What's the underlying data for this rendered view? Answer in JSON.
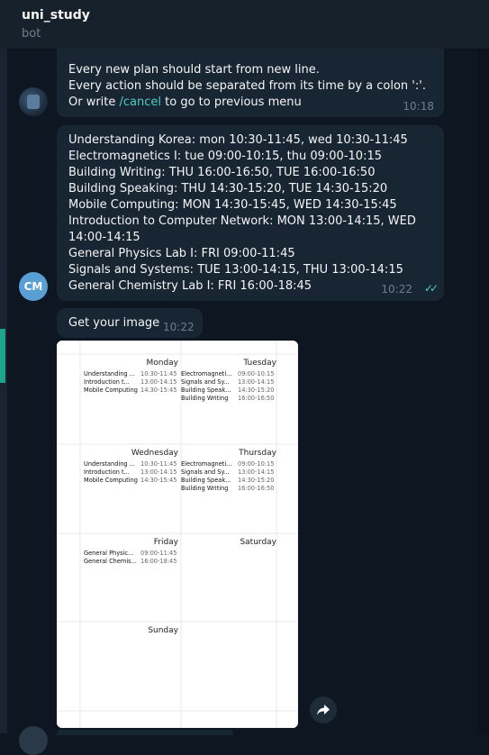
{
  "header": {
    "title": "uni_study",
    "subtitle": "bot"
  },
  "messages": {
    "instructions": {
      "lines": [
        "Every new plan should start from new line.",
        "Every action should be separated from its time by a colon ':'."
      ],
      "cancel_prefix": "Or write ",
      "cancel_link": "/cancel",
      "cancel_suffix": " to go to previous menu",
      "time": "10:18"
    },
    "user_plan": {
      "avatar_initials": "CM",
      "lines": [
        "Understanding Korea: mon 10:30-11:45, wed 10:30-11:45",
        "Electromagnetics I: tue 09:00-10:15, thu 09:00-10:15",
        "Building Writing: THU 16:00-16:50, TUE 16:00-16:50",
        "Building Speaking: THU 14:30-15:20, TUE 14:30-15:20",
        "Mobile Computing: MON 14:30-15:45, WED 14:30-15:45",
        "Introduction to Computer Network: MON 13:00-14:15, WED",
        "14:00-14:15",
        "General Physics Lab I: FRI 09:00-11:45",
        "Signals and Systems: TUE 13:00-14:15, THU 13:00-14:15",
        "General Chemistry Lab I: FRI 16:00-18:45"
      ],
      "time": "10:22",
      "status_icon": "double-check-icon"
    },
    "get_image": {
      "text": "Get your image",
      "time": "10:22"
    }
  },
  "schedule_image": {
    "days": [
      {
        "name": "Monday",
        "entries": [
          {
            "name": "Understanding ...",
            "time": "10:30-11:45"
          },
          {
            "name": "Introduction t...",
            "time": "13:00-14:15"
          },
          {
            "name": "Mobile Computing",
            "time": "14:30-15:45"
          }
        ]
      },
      {
        "name": "Tuesday",
        "entries": [
          {
            "name": "Electromagneti...",
            "time": "09:00-10:15"
          },
          {
            "name": "Signals and Sy...",
            "time": "13:00-14:15"
          },
          {
            "name": "Building Speak...",
            "time": "14:30-15:20"
          },
          {
            "name": "Building Writing",
            "time": "16:00-16:50"
          }
        ]
      },
      {
        "name": "Wednesday",
        "entries": [
          {
            "name": "Understanding ...",
            "time": "10:30-11:45"
          },
          {
            "name": "Introduction t...",
            "time": "13:00-14:15"
          },
          {
            "name": "Mobile Computing",
            "time": "14:30-15:45"
          }
        ]
      },
      {
        "name": "Thursday",
        "entries": [
          {
            "name": "Electromagneti...",
            "time": "09:00-10:15"
          },
          {
            "name": "Signals and Sy...",
            "time": "13:00-14:15"
          },
          {
            "name": "Building Speak...",
            "time": "14:30-15:20"
          },
          {
            "name": "Building Writing",
            "time": "16:00-16:50"
          }
        ]
      },
      {
        "name": "Friday",
        "entries": [
          {
            "name": "General Physic...",
            "time": "09:00-11:45"
          },
          {
            "name": "General Chemis...",
            "time": "16:00-18:45"
          }
        ]
      },
      {
        "name": "Saturday",
        "entries": []
      },
      {
        "name": "Sunday",
        "entries": []
      }
    ]
  },
  "actions": {
    "share_icon": "share-arrow-icon"
  },
  "colors": {
    "background": "#0e1621",
    "header": "#17212b",
    "bubble": "#182533",
    "accent": "#4ecdc4",
    "muted_text": "#6d7f8f",
    "avatar_cm": "#5a9fd4"
  }
}
